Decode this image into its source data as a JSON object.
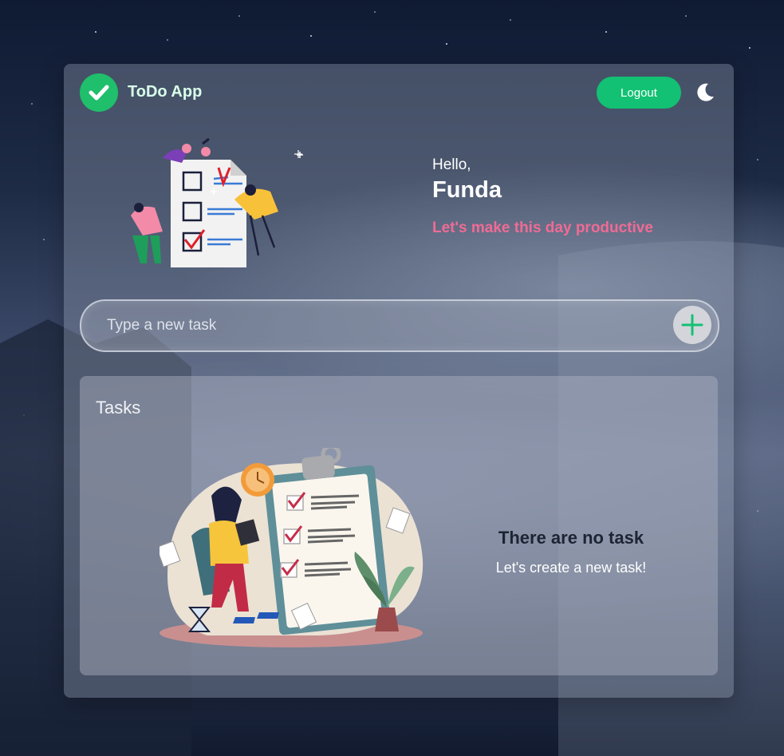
{
  "header": {
    "app_title": "ToDo App",
    "logout_label": "Logout",
    "theme_toggle_icon": "moon-icon",
    "logo_icon": "check-icon"
  },
  "greeting": {
    "hello": "Hello,",
    "user_name": "Funda",
    "motto": "Let's make this day productive"
  },
  "new_task": {
    "placeholder": "Type a new task",
    "value": "",
    "add_icon": "plus-icon"
  },
  "tasks": {
    "title": "Tasks",
    "empty_title": "There are no task",
    "empty_subtitle": "Let's create a new task!",
    "items": []
  },
  "colors": {
    "accent_green": "#12c173",
    "motto_pink": "#f06b95",
    "empty_title": "#1e2433"
  }
}
